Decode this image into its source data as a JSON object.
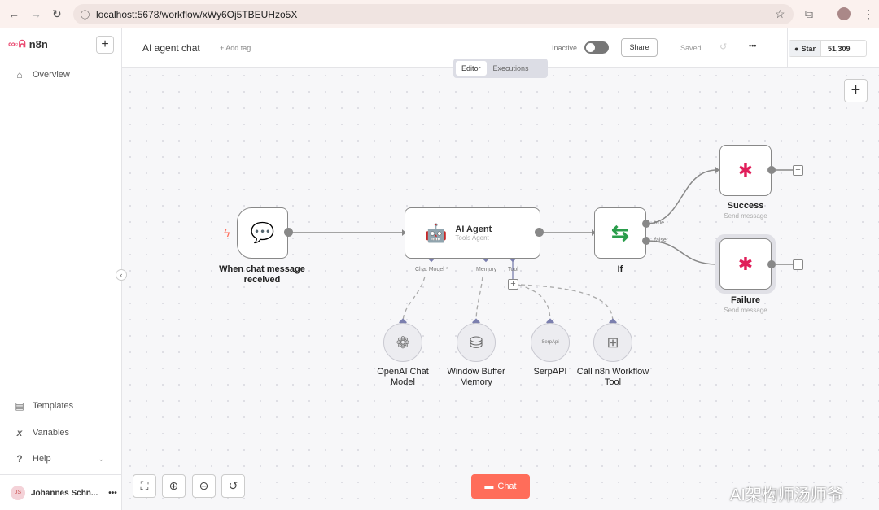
{
  "browser": {
    "url": "localhost:5678/workflow/xWy6Oj5TBEUHzo5X"
  },
  "sidebar": {
    "brand": "n8n",
    "items": [
      {
        "label": "Overview",
        "icon": "home-icon"
      }
    ],
    "bottom_items": [
      {
        "label": "Templates",
        "icon": "templates-icon"
      },
      {
        "label": "Variables",
        "icon": "variables-icon"
      },
      {
        "label": "Help",
        "icon": "help-icon"
      }
    ],
    "user": {
      "initials": "JS",
      "name": "Johannes Schn..."
    }
  },
  "header": {
    "workflow_name": "AI agent chat",
    "add_tag": "+ Add tag",
    "status": "Inactive",
    "active": false,
    "share": "Share",
    "saved": "Saved",
    "github_star": "Star",
    "github_count": "51,309"
  },
  "tabs": [
    {
      "label": "Editor",
      "active": true
    },
    {
      "label": "Executions",
      "active": false
    }
  ],
  "nodes": {
    "trigger": {
      "title": "When chat message received"
    },
    "agent": {
      "title": "AI Agent",
      "subtitle": "Tools Agent",
      "ports": [
        "Chat Model *",
        "Memory",
        "Tool"
      ]
    },
    "if": {
      "title": "If",
      "outputs": [
        "true",
        "false"
      ]
    },
    "success": {
      "title": "Success",
      "subtitle": "Send message"
    },
    "failure": {
      "title": "Failure",
      "subtitle": "Send message"
    },
    "openai": {
      "title": "OpenAI Chat Model"
    },
    "memory": {
      "title": "Window Buffer Memory"
    },
    "serp": {
      "title": "SerpAPI",
      "icon_text": "SerpApi"
    },
    "workflow_tool": {
      "title": "Call n8n Workflow Tool"
    }
  },
  "chat_button": "Chat",
  "watermark": "AI架构师汤师爷",
  "colors": {
    "accent": "#ff6d5a",
    "port": "#7b7fae",
    "if_green": "#2a9d4b"
  }
}
